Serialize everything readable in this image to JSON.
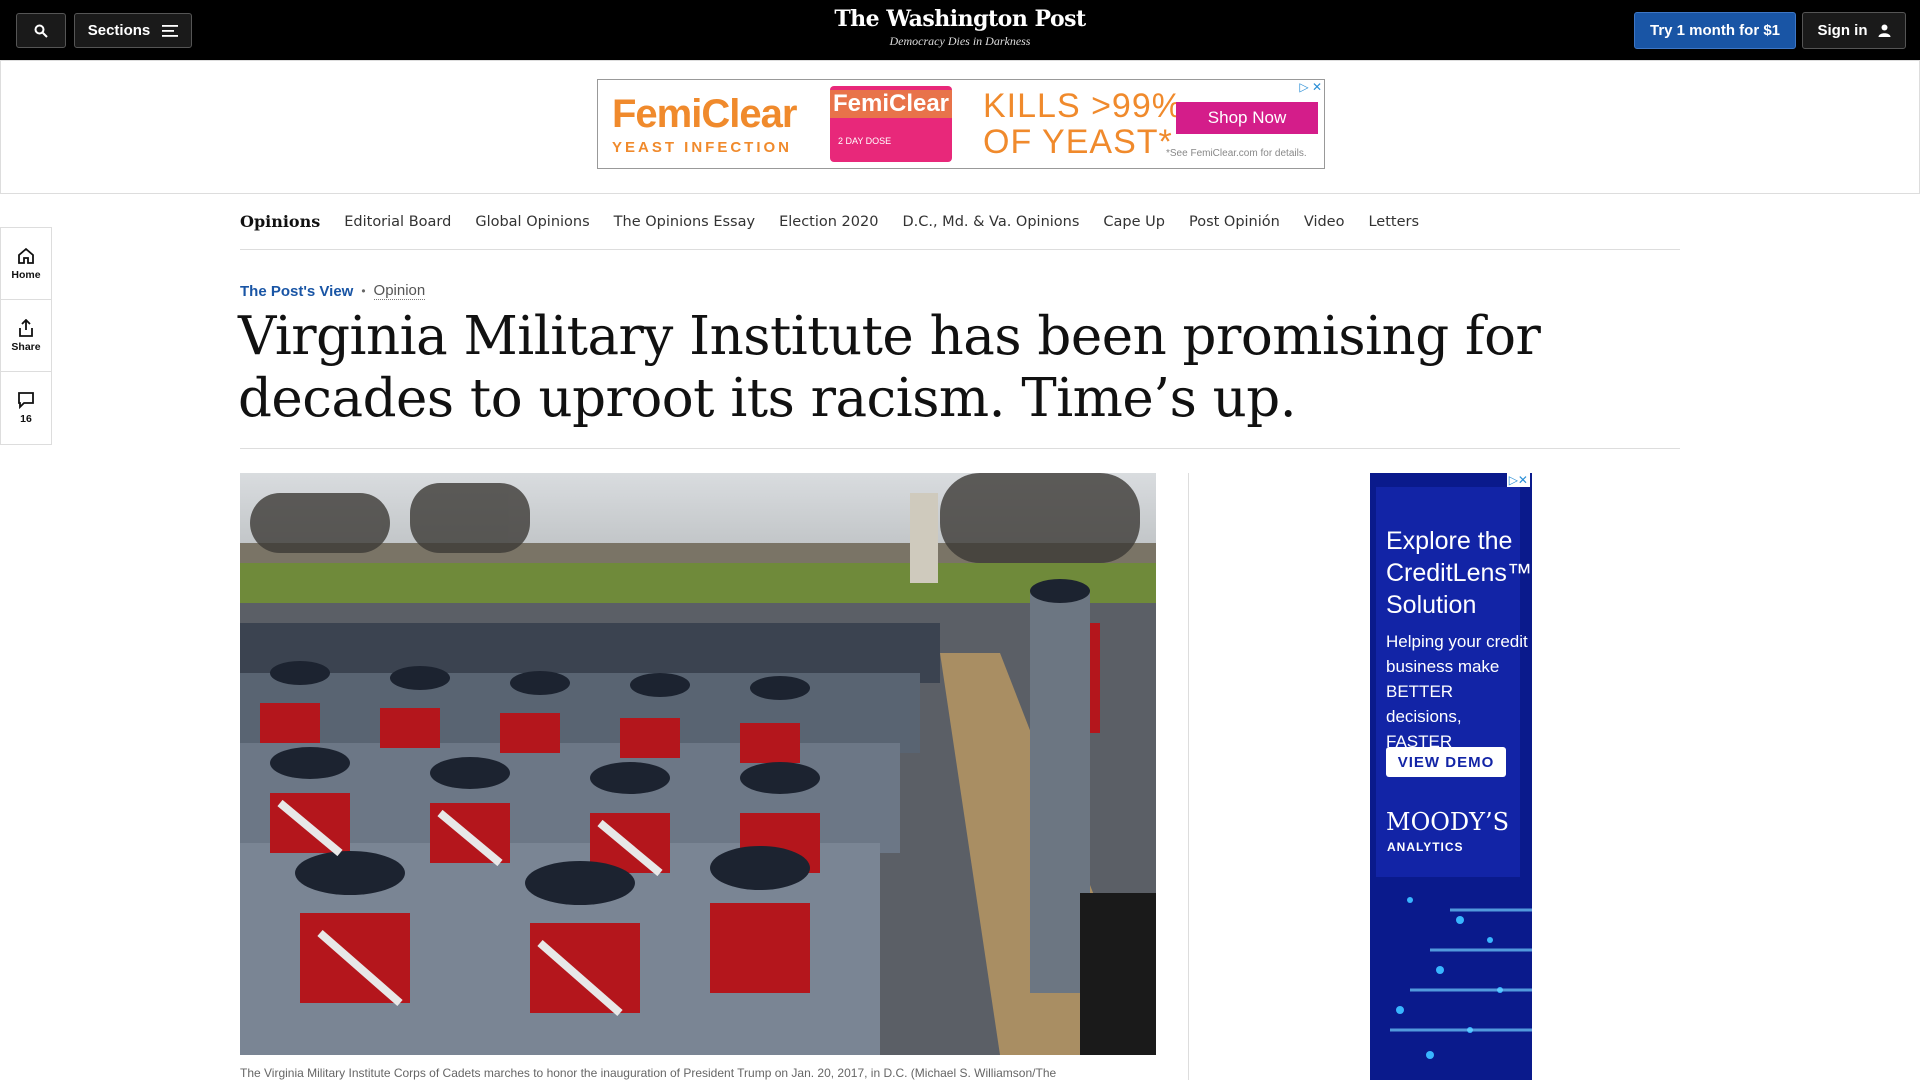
{
  "header": {
    "sections_label": "Sections",
    "logo": "The Washington Post",
    "tagline": "Democracy Dies in Darkness",
    "subscribe_label": "Try 1 month for $1",
    "signin_label": "Sign in"
  },
  "top_ad": {
    "brand": "FemiClear",
    "brand_sub": "YEAST INFECTION",
    "box_brand": "FemiClear",
    "box_dose": "2 DAY DOSE",
    "claim_line1": "KILLS >99%",
    "claim_line2": "OF YEAST*",
    "cta": "Shop Now",
    "fine_print": "*See FemiClear.com for details."
  },
  "subnav": {
    "title": "Opinions",
    "items": [
      "Editorial Board",
      "Global Opinions",
      "The Opinions Essay",
      "Election 2020",
      "D.C., Md. & Va. Opinions",
      "Cape Up",
      "Post Opinión",
      "Video",
      "Letters"
    ]
  },
  "rail": {
    "home_label": "Home",
    "share_label": "Share",
    "comments_count": "16"
  },
  "article": {
    "series": "The Post's View",
    "label": "Opinion",
    "headline": "Virginia Military Institute has been promising for decades to uproot its racism. Time’s up.",
    "caption": "The Virginia Military Institute Corps of Cadets marches to honor the inauguration of President Trump on Jan. 20, 2017, in D.C. (Michael S. Williamson/The"
  },
  "side_ad": {
    "headline": "Explore the CreditLens™ Solution",
    "body": "Helping your credit business make BETTER decisions, FASTER",
    "cta": "VIEW DEMO",
    "brand": "MOODY’S",
    "brand_sub": "ANALYTICS"
  },
  "colors": {
    "accent_blue": "#1955a5",
    "ad_orange": "#f08a2c",
    "ad_pink": "#d41d8a",
    "side_ad_blue": "#0a1a8c"
  }
}
